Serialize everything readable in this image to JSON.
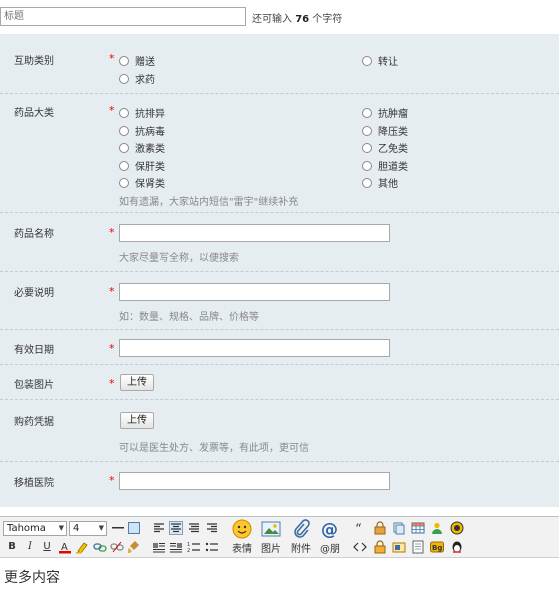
{
  "title_field": {
    "placeholder": "标题",
    "hint_prefix": "还可输入",
    "remaining": "76",
    "hint_suffix": "个字符"
  },
  "form": {
    "help_type": {
      "label": "互助类别",
      "required": "*",
      "options": [
        "赠送",
        "求药",
        "转让"
      ]
    },
    "drug_category": {
      "label": "药品大类",
      "required": "*",
      "options_left": [
        "抗排异",
        "抗病毒",
        "激素类",
        "保肝类",
        "保肾类"
      ],
      "options_right": [
        "抗肿瘤",
        "降压类",
        "乙免类",
        "胆道类",
        "其他"
      ],
      "tip": "如有遗漏，大家站内短信\"雷宇\"继续补充"
    },
    "drug_name": {
      "label": "药品名称",
      "required": "*",
      "tip": "大家尽量写全称，以便搜索"
    },
    "required_note": {
      "label": "必要说明",
      "required": "*",
      "tip": "如：数量、规格、品牌、价格等"
    },
    "expiry": {
      "label": "有效日期",
      "required": "*"
    },
    "package_image": {
      "label": "包装图片",
      "required": "*",
      "button": "上传"
    },
    "purchase_proof": {
      "label": "购药凭据",
      "button": "上传",
      "tip": "可以是医生处方、发票等，有此项，更可信"
    },
    "hospital": {
      "label": "移植医院",
      "required": "*"
    }
  },
  "editor": {
    "font_family": "Tahoma",
    "font_size": "4",
    "buttons": {
      "emoji": "表情",
      "image": "图片",
      "attach": "附件",
      "mention": "@朋"
    },
    "format": {
      "bold": "B",
      "italic": "I",
      "underline": "U"
    },
    "placeholder": "更多内容"
  }
}
